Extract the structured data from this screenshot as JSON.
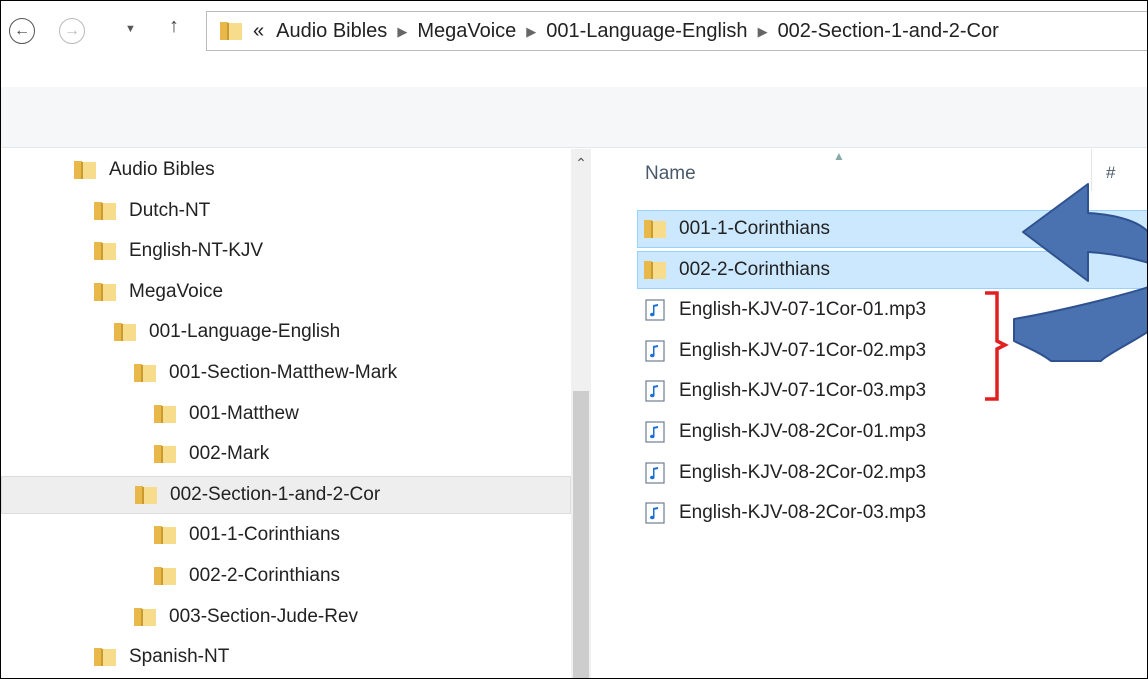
{
  "address_bar": {
    "overflow_marker": "«",
    "breadcrumbs": [
      "Audio Bibles",
      "MegaVoice",
      "001-Language-English",
      "002-Section-1-and-2-Cor"
    ]
  },
  "navigation_pane": {
    "items": [
      {
        "label": "Audio Bibles",
        "selected": false
      },
      {
        "label": "Dutch-NT",
        "selected": false
      },
      {
        "label": "English-NT-KJV",
        "selected": false
      },
      {
        "label": "MegaVoice",
        "selected": false
      },
      {
        "label": "001-Language-English",
        "selected": false
      },
      {
        "label": "001-Section-Matthew-Mark",
        "selected": false
      },
      {
        "label": "001-Matthew",
        "selected": false
      },
      {
        "label": "002-Mark",
        "selected": false
      },
      {
        "label": "002-Section-1-and-2-Cor",
        "selected": true
      },
      {
        "label": "001-1-Corinthians",
        "selected": false
      },
      {
        "label": "002-2-Corinthians",
        "selected": false
      },
      {
        "label": "003-Section-Jude-Rev",
        "selected": false
      },
      {
        "label": "Spanish-NT",
        "selected": false
      }
    ]
  },
  "file_list": {
    "columns": [
      "Name",
      "#"
    ],
    "rows": [
      {
        "name": "001-1-Corinthians",
        "type": "folder",
        "selected": true
      },
      {
        "name": "002-2-Corinthians",
        "type": "folder",
        "selected": true
      },
      {
        "name": "English-KJV-07-1Cor-01.mp3",
        "type": "mp3",
        "selected": false
      },
      {
        "name": "English-KJV-07-1Cor-02.mp3",
        "type": "mp3",
        "selected": false
      },
      {
        "name": "English-KJV-07-1Cor-03.mp3",
        "type": "mp3",
        "selected": false
      },
      {
        "name": "English-KJV-08-2Cor-01.mp3",
        "type": "mp3",
        "selected": false
      },
      {
        "name": "English-KJV-08-2Cor-02.mp3",
        "type": "mp3",
        "selected": false
      },
      {
        "name": "English-KJV-08-2Cor-03.mp3",
        "type": "mp3",
        "selected": false
      }
    ]
  },
  "annotations": {
    "arrow_color": "#4a72b0",
    "arrow_outline": "#2f528f",
    "bracket_color": "#e02020"
  },
  "colors": {
    "folder_main": "#e8b84a",
    "folder_light": "#f7dc8c",
    "selection_fill": "#cce8ff",
    "selection_border": "#99d1ff"
  }
}
